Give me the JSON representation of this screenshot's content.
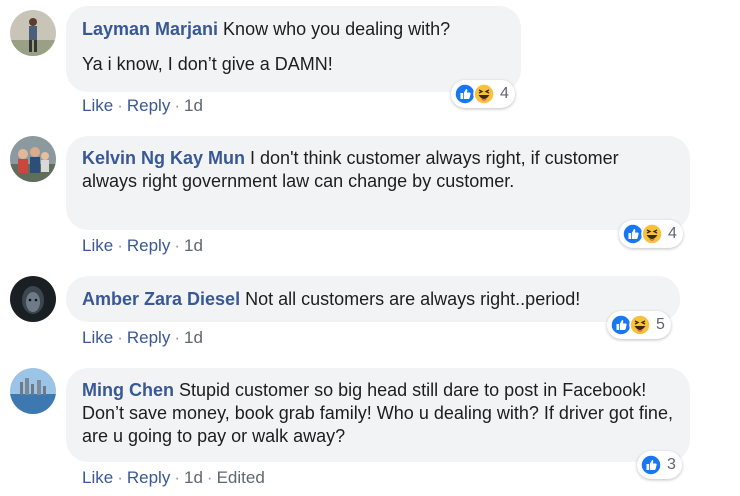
{
  "comments": [
    {
      "author": "Layman Marjani",
      "text": " Know who you dealing with?",
      "text2": "Ya i know, I don’t give a DAMN!",
      "actions": {
        "like": "Like",
        "reply": "Reply",
        "time": "1d"
      },
      "reactions": {
        "icons": [
          "like-icon",
          "haha-icon"
        ],
        "count": "4"
      }
    },
    {
      "author": "Kelvin Ng Kay Mun",
      "text": " I don't think customer always right, if customer always right government law can change by customer.",
      "actions": {
        "like": "Like",
        "reply": "Reply",
        "time": "1d"
      },
      "reactions": {
        "icons": [
          "like-icon",
          "haha-icon"
        ],
        "count": "4"
      }
    },
    {
      "author": "Amber Zara Diesel",
      "text": " Not all customers are always right..period!",
      "actions": {
        "like": "Like",
        "reply": "Reply",
        "time": "1d"
      },
      "reactions": {
        "icons": [
          "like-icon",
          "haha-icon"
        ],
        "count": "5"
      }
    },
    {
      "author": "Ming Chen",
      "text": " Stupid customer so big head still dare to post in Facebook! Don’t save money, book grab family! Who u dealing with? If driver got fine, are u going to pay or walk away?",
      "actions": {
        "like": "Like",
        "reply": "Reply",
        "time": "1d",
        "edited": "Edited"
      },
      "reactions": {
        "icons": [
          "like-icon"
        ],
        "count": "3"
      }
    }
  ],
  "separator": "·",
  "colors": {
    "author": "#385898",
    "bubble": "#f2f3f5",
    "meta": "#606770",
    "like_blue": "#1877f2",
    "haha_yellow": "#f7c23a"
  }
}
